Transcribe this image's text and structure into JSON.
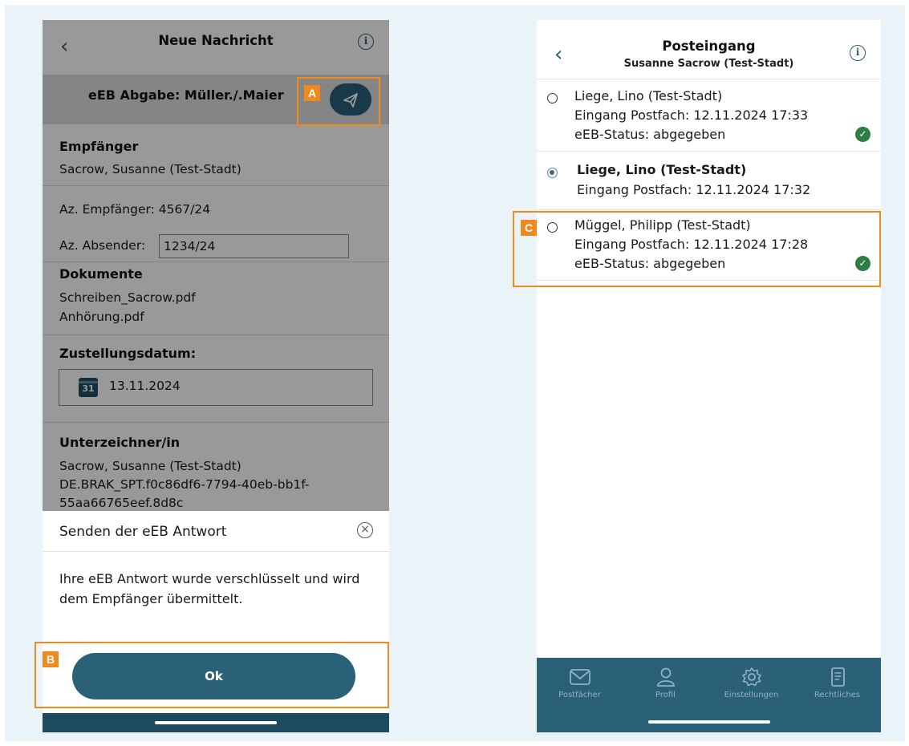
{
  "left": {
    "header_title": "Neue Nachricht",
    "subject": "eEB Abgabe: Müller./.Maier",
    "recipient": {
      "heading": "Empfänger",
      "name": "Sacrow, Susanne (Test-Stadt)"
    },
    "references": {
      "recipient_label": "Az. Empfänger: 4567/24",
      "sender_label": "Az. Absender:",
      "sender_value": "1234/24"
    },
    "documents": {
      "heading": "Dokumente",
      "items": [
        "Schreiben_Sacrow.pdf",
        "Anhörung.pdf"
      ]
    },
    "delivery": {
      "heading": "Zustellungsdatum:",
      "calendar_day": "31",
      "date": "13.11.2024"
    },
    "signer": {
      "heading": "Unterzeichner/in",
      "lines": [
        "Sacrow, Susanne (Test-Stadt)",
        "DE.BRAK_SPT.f0c86df6-7794-40eb-bb1f-",
        "55aa66765eef.8d8c"
      ]
    },
    "modal": {
      "title": "Senden der eEB Antwort",
      "body": "Ihre eEB Antwort wurde verschlüsselt und wird dem Empfänger übermittelt.",
      "ok_label": "Ok"
    }
  },
  "right": {
    "header_title": "Posteingang",
    "header_subtitle": "Susanne Sacrow (Test-Stadt)",
    "messages": [
      {
        "sender": "Liege, Lino (Test-Stadt)",
        "received": "Eingang Postfach: 12.11.2024 17:33",
        "status": "eEB-Status: abgegeben",
        "selected": false,
        "status_icon": "check-icon"
      },
      {
        "sender": "Liege, Lino (Test-Stadt)",
        "received": "Eingang Postfach: 12.11.2024 17:32",
        "status": "",
        "selected": true
      },
      {
        "sender": "Müggel, Philipp (Test-Stadt)",
        "received": "Eingang Postfach: 12.11.2024 17:28",
        "status": "eEB-Status: abgegeben",
        "selected": false,
        "status_icon": "check-icon"
      }
    ],
    "tabs": [
      {
        "label": "Postfächer",
        "icon": "mail-icon"
      },
      {
        "label": "Profil",
        "icon": "person-icon"
      },
      {
        "label": "Einstellungen",
        "icon": "gear-icon"
      },
      {
        "label": "Rechtliches",
        "icon": "document-icon"
      }
    ]
  },
  "annotations": {
    "a": "A",
    "b": "B",
    "c": "C"
  },
  "colors": {
    "brand": "#2a6078",
    "accent": "#f08a1e",
    "success": "#2e7d44",
    "background": "#e9f3f8"
  }
}
